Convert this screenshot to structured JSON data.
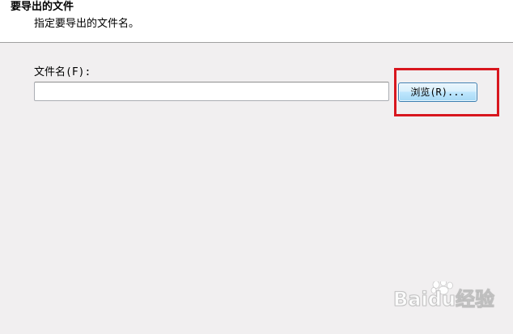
{
  "header": {
    "title": "要导出的文件",
    "subtitle": "指定要导出的文件名。"
  },
  "form": {
    "filename_label": "文件名(F):",
    "filename_value": "",
    "browse_label": "浏览(R)..."
  },
  "colors": {
    "highlight": "#d8161e",
    "body_background": "#f1eff0",
    "header_background": "#ffffff"
  },
  "watermark": {
    "text": "Baidu经验"
  }
}
